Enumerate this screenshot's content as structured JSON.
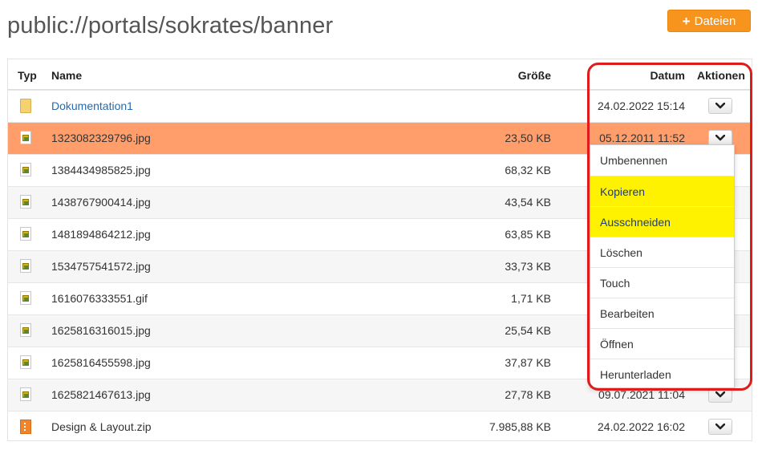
{
  "page": {
    "title": "public://portals/sokrates/banner",
    "upload_button": "Dateien"
  },
  "table": {
    "headers": {
      "type": "Typ",
      "name": "Name",
      "size": "Größe",
      "date": "Datum",
      "actions": "Aktionen"
    },
    "rows": [
      {
        "icon": "folder-icon",
        "name": "Dokumentation1",
        "size": "",
        "date": "24.02.2022 15:14",
        "selected": false
      },
      {
        "icon": "image-file-icon",
        "name": "1323082329796.jpg",
        "size": "23,50 KB",
        "date": "05.12.2011 11:52",
        "selected": true
      },
      {
        "icon": "image-file-icon",
        "name": "1384434985825.jpg",
        "size": "68,32 KB",
        "date": "",
        "selected": false
      },
      {
        "icon": "image-file-icon",
        "name": "1438767900414.jpg",
        "size": "43,54 KB",
        "date": "",
        "selected": false
      },
      {
        "icon": "image-file-icon",
        "name": "1481894864212.jpg",
        "size": "63,85 KB",
        "date": "",
        "selected": false
      },
      {
        "icon": "image-file-icon",
        "name": "1534757541572.jpg",
        "size": "33,73 KB",
        "date": "",
        "selected": false
      },
      {
        "icon": "image-file-icon",
        "name": "1616076333551.gif",
        "size": "1,71 KB",
        "date": "",
        "selected": false
      },
      {
        "icon": "image-file-icon",
        "name": "1625816316015.jpg",
        "size": "25,54 KB",
        "date": "",
        "selected": false
      },
      {
        "icon": "image-file-icon",
        "name": "1625816455598.jpg",
        "size": "37,87 KB",
        "date": "",
        "selected": false
      },
      {
        "icon": "image-file-icon",
        "name": "1625821467613.jpg",
        "size": "27,78 KB",
        "date": "09.07.2021 11:04",
        "selected": false
      },
      {
        "icon": "zip-file-icon",
        "name": "Design & Layout.zip",
        "size": "7.985,88 KB",
        "date": "24.02.2022 16:02",
        "selected": false
      }
    ]
  },
  "actions_menu": {
    "items": [
      {
        "label": "Umbenennen",
        "highlighted": false
      },
      {
        "label": "Kopieren",
        "highlighted": true
      },
      {
        "label": "Ausschneiden",
        "highlighted": true
      },
      {
        "label": "Löschen",
        "highlighted": false
      },
      {
        "label": "Touch",
        "highlighted": false
      },
      {
        "label": "Bearbeiten",
        "highlighted": false
      },
      {
        "label": "Öffnen",
        "highlighted": false
      },
      {
        "label": "Herunterladen",
        "highlighted": false
      }
    ]
  },
  "colors": {
    "selected_row": "#ff9e6a",
    "upload_button": "#f7941d",
    "menu_highlight": "#fff200",
    "annotation_border": "#e01b1b",
    "link": "#2a6aa8"
  }
}
